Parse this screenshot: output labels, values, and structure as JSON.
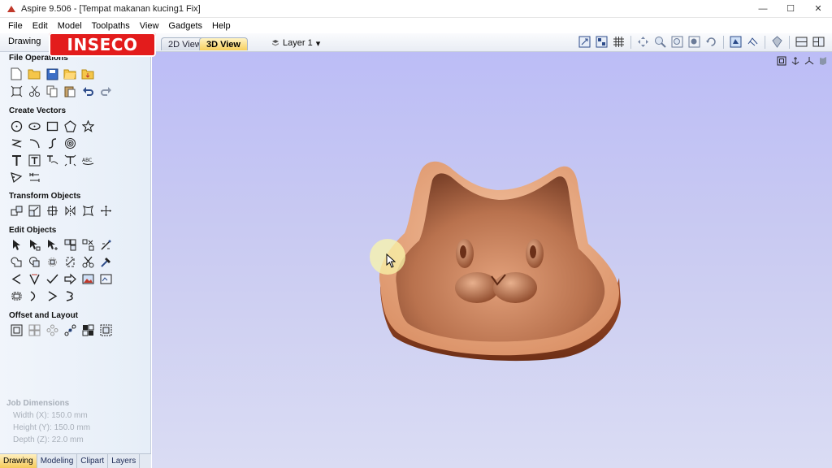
{
  "window": {
    "title": "Aspire 9.506 - [Tempat makanan kucing1 Fix]",
    "buttons": {
      "minimize": "—",
      "maximize": "☐",
      "close": "✕"
    }
  },
  "menu": [
    "File",
    "Edit",
    "Model",
    "Toolpaths",
    "View",
    "Gadgets",
    "Help"
  ],
  "toolbar": {
    "drawing_label": "Drawing",
    "tab_2d": "2D View",
    "tab_3d": "3D View",
    "layer_label": "Layer 1",
    "layer_arrow": "▾"
  },
  "overlay_logo": "INSECO",
  "left_panel": {
    "sections": [
      {
        "title": "File Operations",
        "icons": [
          "new-file-icon",
          "open-file-icon",
          "save-icon",
          "open-folder-icon",
          "import-icon",
          "fit-view-icon",
          "cut-icon",
          "copy-icon",
          "paste-icon",
          "undo-icon",
          "redo-icon"
        ]
      },
      {
        "title": "Create Vectors",
        "icons": [
          "circle-icon",
          "ellipse-icon",
          "rectangle-icon",
          "polygon-icon",
          "star-icon",
          "polyline-icon",
          "arc-icon",
          "curve-icon",
          "spiral-icon",
          "text-icon",
          "text-on-curve-icon",
          "auto-layout-text-icon",
          "bend-text-icon",
          "vector-text-icon",
          "dimension-icon",
          "fillet-icon"
        ]
      },
      {
        "title": "Transform Objects",
        "icons": [
          "move-icon",
          "scale-icon",
          "rotate-icon",
          "mirror-icon",
          "distort-icon",
          "align-icon"
        ]
      },
      {
        "title": "Edit Objects",
        "icons": [
          "select-icon",
          "node-edit-icon",
          "transform-icon",
          "group-icon",
          "ungroup-icon",
          "smart-snap-icon",
          "weld-icon",
          "trim-icon",
          "join-icon",
          "close-vector-icon",
          "scissors-icon",
          "smooth-icon",
          "curve-fit-icon",
          "fillet-vector-icon",
          "check-icon",
          "offset-arrow-icon",
          "image-icon",
          "trace-icon",
          "boundary-icon",
          "extend-icon",
          "inner-icon",
          "outer-icon"
        ]
      },
      {
        "title": "Offset and Layout",
        "icons": [
          "offset-icon",
          "array-copy-icon",
          "circular-array-icon",
          "nest-icon",
          "step-repeat-icon",
          "copy-along-icon"
        ]
      }
    ]
  },
  "job_dimensions": {
    "title": "Job Dimensions",
    "width": "Width  (X): 150.0 mm",
    "height": "Height (Y): 150.0 mm",
    "depth": "Depth  (Z): 22.0 mm"
  },
  "bottom_tabs": [
    "Drawing",
    "Modeling",
    "Clipart",
    "Layers"
  ]
}
